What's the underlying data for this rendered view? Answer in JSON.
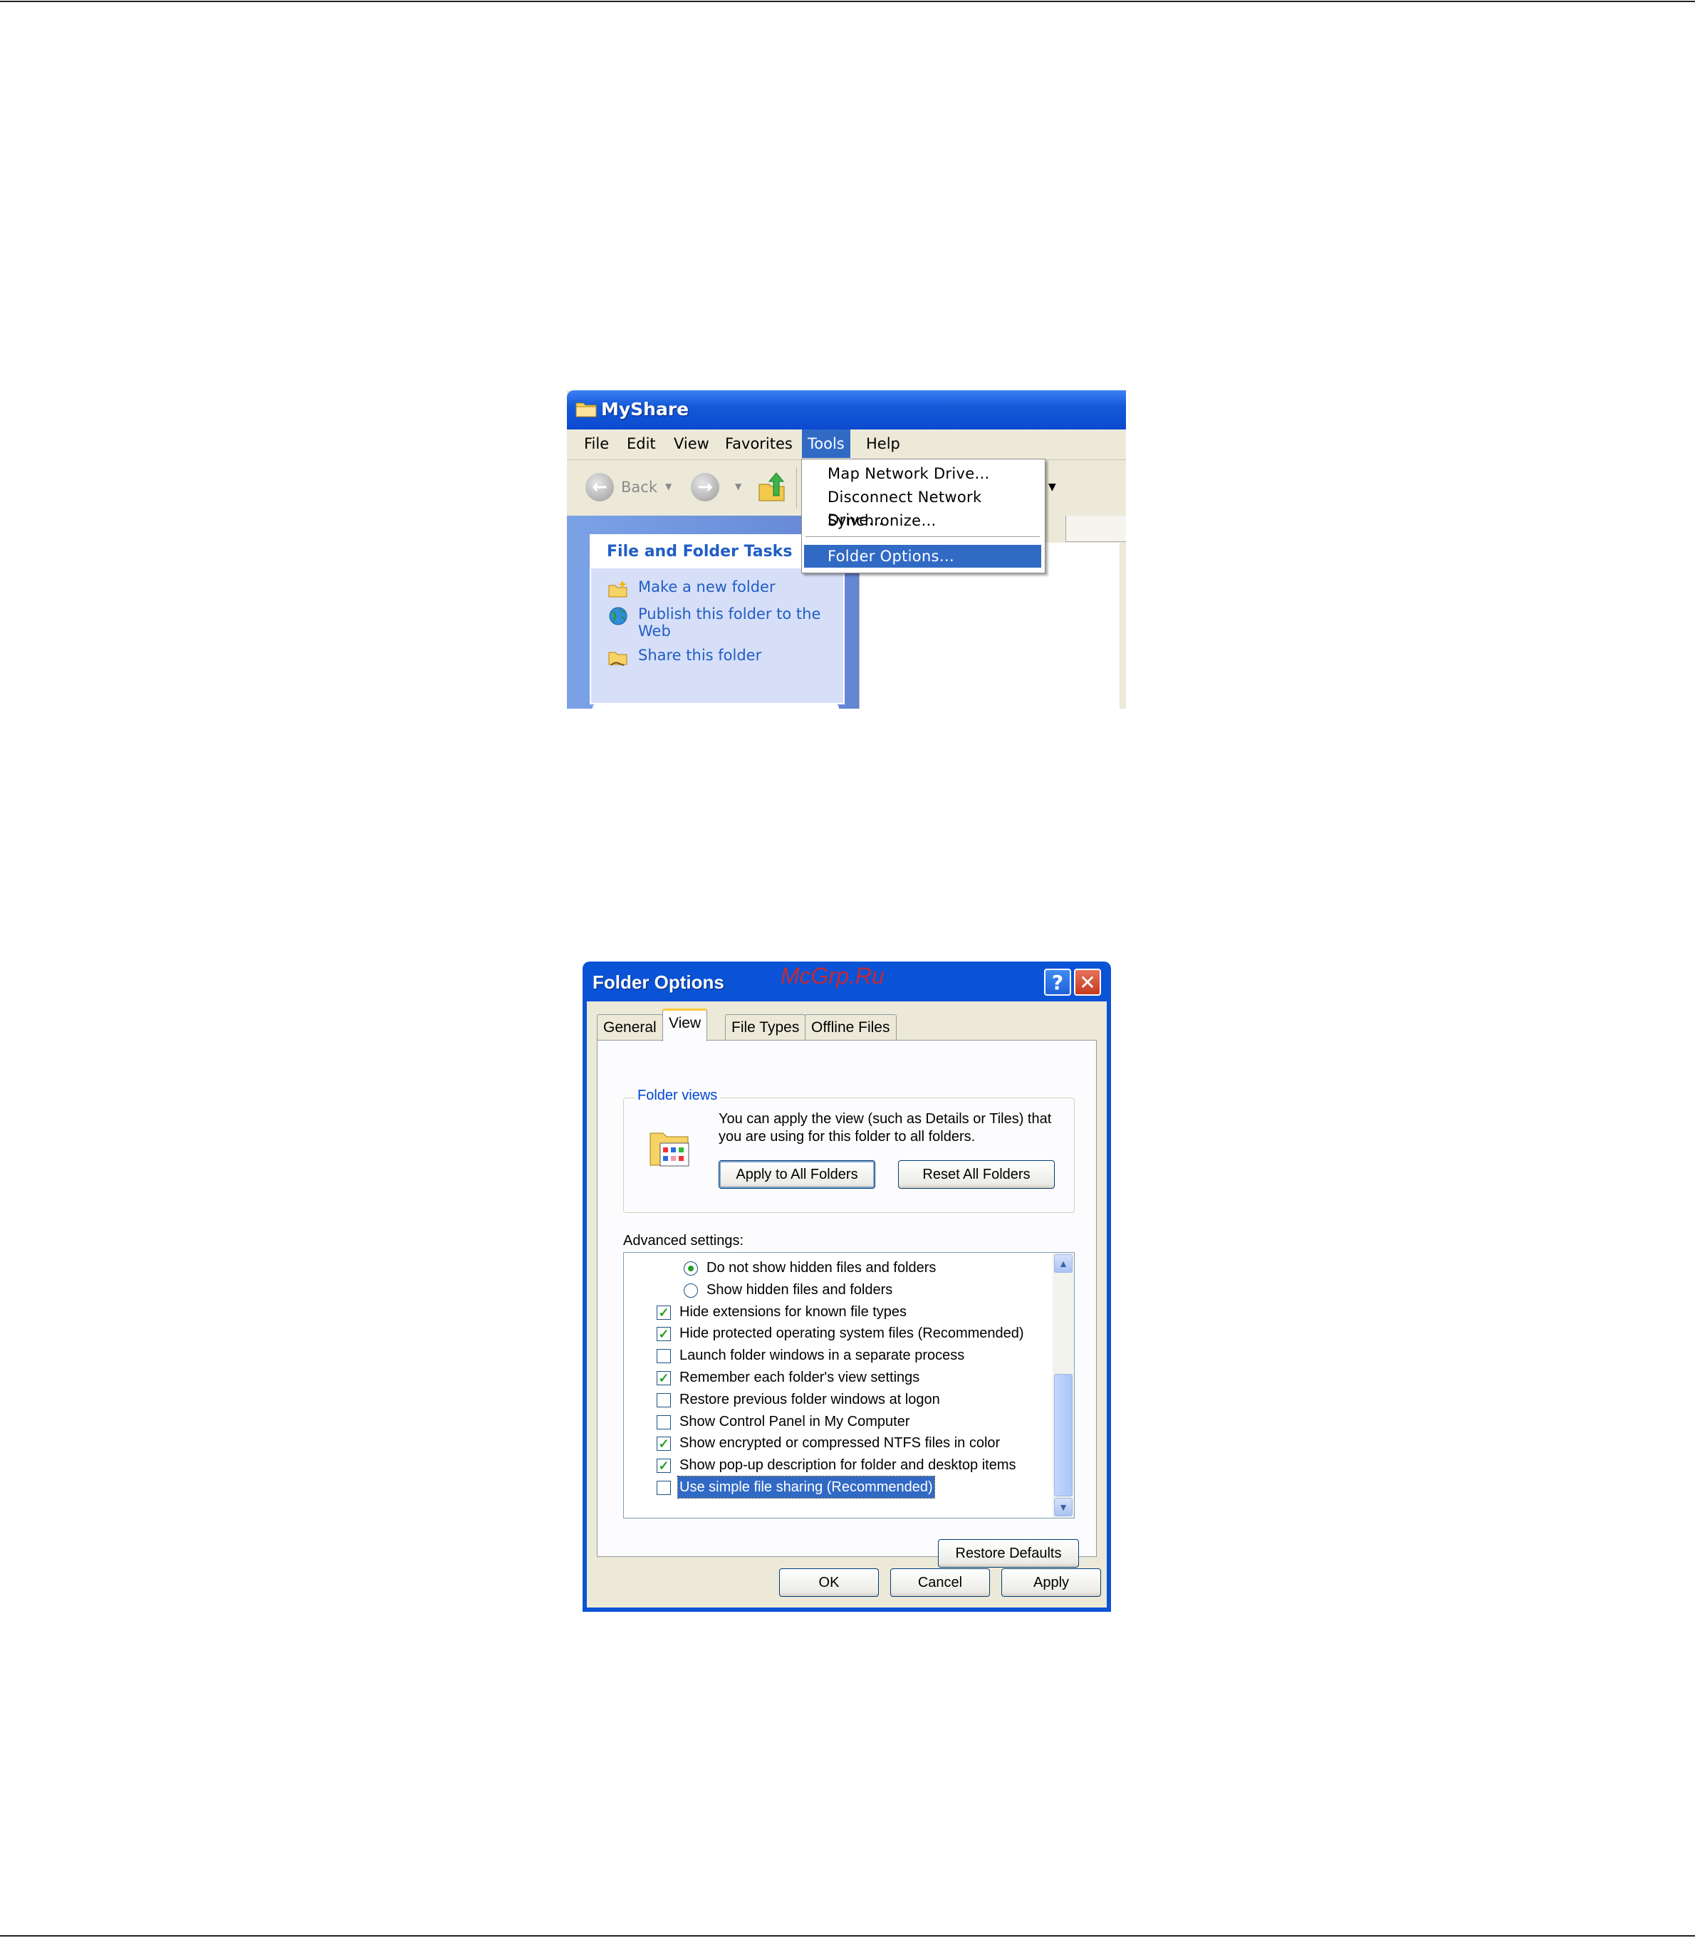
{
  "explorer": {
    "title": "MyShare",
    "menu": [
      "File",
      "Edit",
      "View",
      "Favorites",
      "Tools",
      "Help"
    ],
    "toolbar": {
      "back_label": "Back"
    },
    "tasks_panel": {
      "header": "File and Folder Tasks",
      "items": [
        "Make a new folder",
        "Publish this folder to the Web",
        "Share this folder"
      ]
    }
  },
  "tools_menu": {
    "items": [
      "Map Network Drive…",
      "Disconnect Network Drive…",
      "Synchronize…",
      "Folder Options…"
    ],
    "highlighted": "Folder Options…"
  },
  "dialog": {
    "title": "Folder Options",
    "watermark": "McGrp.Ru",
    "help_glyph": "?",
    "close_glyph": "✕",
    "tabs": [
      "General",
      "View",
      "File Types",
      "Offline Files"
    ],
    "selected_tab": "View",
    "folder_views": {
      "legend": "Folder views",
      "description": "You can apply the view (such as Details or Tiles) that you are using for this folder to all folders.",
      "apply_button": "Apply to All Folders",
      "reset_button": "Reset All Folders"
    },
    "advanced_label": "Advanced settings:",
    "advanced_items": [
      {
        "type": "radio",
        "checked": true,
        "label": "Do not show hidden files and folders"
      },
      {
        "type": "radio",
        "checked": false,
        "label": "Show hidden files and folders"
      },
      {
        "type": "checkbox",
        "checked": true,
        "label": "Hide extensions for known file types"
      },
      {
        "type": "checkbox",
        "checked": true,
        "label": "Hide protected operating system files (Recommended)"
      },
      {
        "type": "checkbox",
        "checked": false,
        "label": "Launch folder windows in a separate process"
      },
      {
        "type": "checkbox",
        "checked": true,
        "label": "Remember each folder's view settings"
      },
      {
        "type": "checkbox",
        "checked": false,
        "label": "Restore previous folder windows at logon"
      },
      {
        "type": "checkbox",
        "checked": false,
        "label": "Show Control Panel in My Computer"
      },
      {
        "type": "checkbox",
        "checked": true,
        "label": "Show encrypted or compressed NTFS files in color"
      },
      {
        "type": "checkbox",
        "checked": true,
        "label": "Show pop-up description for folder and desktop items"
      },
      {
        "type": "checkbox",
        "checked": false,
        "label": "Use simple file sharing (Recommended)",
        "selected": true
      }
    ],
    "restore_defaults": "Restore Defaults",
    "ok": "OK",
    "cancel": "Cancel",
    "apply": "Apply"
  }
}
